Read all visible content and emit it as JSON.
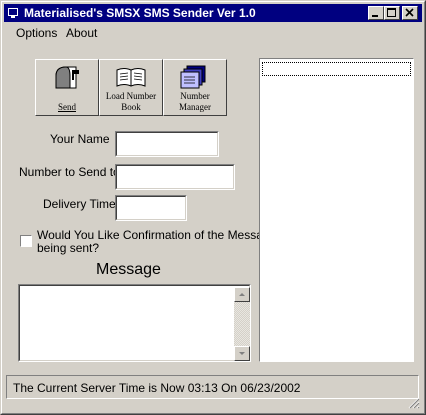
{
  "window": {
    "title": "Materialised's SMSX SMS Sender Ver 1.0",
    "minimize_label": "_",
    "maximize_label": "□",
    "close_label": "×"
  },
  "menu": [
    "Options",
    "About"
  ],
  "toolbar": {
    "send_label": "Send",
    "load_label_1": "Load Number",
    "load_label_2": "Book",
    "manager_label_1": "Number",
    "manager_label_2": "Manager"
  },
  "form": {
    "name_label": "Your Name",
    "name_value": "",
    "number_label": "Number to Send to",
    "number_value": "",
    "delivery_label": "Delivery Time",
    "delivery_value": "",
    "confirm_label_1": "Would You Like Confirmation of the Message",
    "confirm_label_2": "being sent?",
    "confirm_checked": false,
    "message_title": "Message",
    "message_value": ""
  },
  "status": {
    "text": "The Current Server Time is Now 03:13 On 06/23/2002"
  },
  "colors": {
    "face": "#d4d0c8",
    "titlebar": "#000080"
  },
  "icons": {
    "app": "app-icon",
    "send": "mailbox-icon",
    "load": "book-icon",
    "manager": "address-book-icon"
  }
}
